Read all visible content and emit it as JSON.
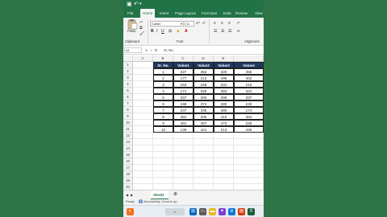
{
  "titlebar": {
    "save_icon": "save-icon",
    "undo_icon": "undo-icon"
  },
  "tabs": [
    "File",
    "Home",
    "Insert",
    "Page Layout",
    "Formulas",
    "Data",
    "Review",
    "View"
  ],
  "ribbon": {
    "paste_label": "Paste",
    "font_name": "Calibri",
    "font_size": "11",
    "clipboard_label": "Clipboard",
    "font_label": "Font",
    "alignment_label": "Alignment"
  },
  "formula_bar": {
    "name_box": "A1",
    "fx": "fx",
    "value": "Sr. No."
  },
  "columns": [
    "A",
    "B",
    "C",
    "D",
    "E",
    "F"
  ],
  "rows": [
    "1",
    "2",
    "3",
    "4",
    "5",
    "6",
    "7",
    "8",
    "9",
    "10",
    "11",
    "12",
    "13",
    "14",
    "15",
    "16",
    "17",
    "18",
    "19",
    "20",
    "21",
    "22"
  ],
  "table": {
    "headers": [
      "Sr. No.",
      "Value1",
      "Value2",
      "Value3",
      "Value4"
    ],
    "rows": [
      [
        "1",
        "327",
        "352",
        "320",
        "455"
      ],
      [
        "2",
        "177",
        "213",
        "496",
        "402"
      ],
      [
        "3",
        "163",
        "158",
        "231",
        "210"
      ],
      [
        "4",
        "171",
        "325",
        "383",
        "331"
      ],
      [
        "5",
        "337",
        "300",
        "286",
        "337"
      ],
      [
        "6",
        "196",
        "374",
        "280",
        "240"
      ],
      [
        "7",
        "237",
        "335",
        "380",
        "174"
      ],
      [
        "8",
        "481",
        "305",
        "410",
        "362"
      ],
      [
        "9",
        "491",
        "487",
        "473",
        "225"
      ],
      [
        "10",
        "139",
        "421",
        "213",
        "426"
      ]
    ]
  },
  "sheet_tab": "Sheet1",
  "status": {
    "ready": "Ready",
    "accessibility": "Accessibility: Good to go"
  },
  "colors": {
    "excel_green": "#217346",
    "header_fill": "#1f3864",
    "background": "#2f7446"
  }
}
